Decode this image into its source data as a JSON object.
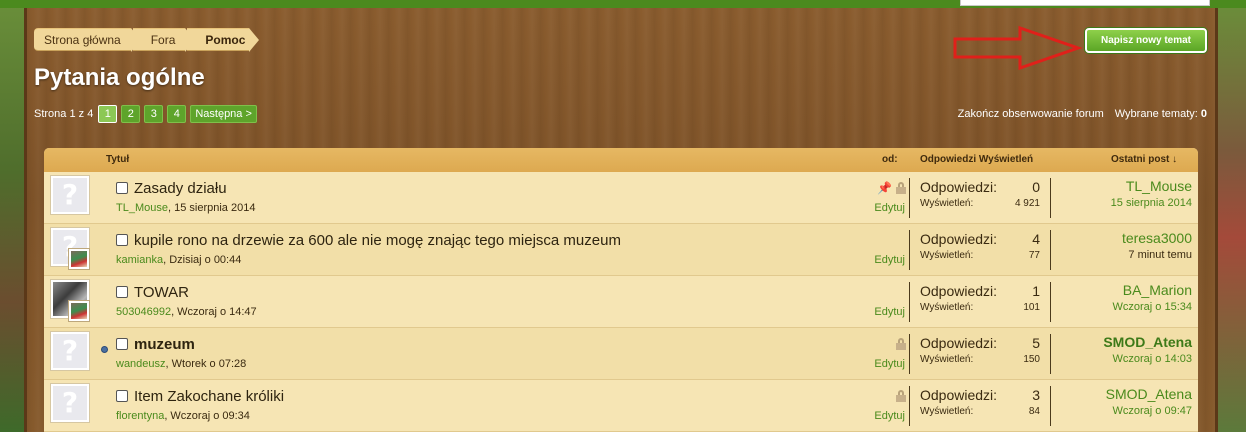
{
  "breadcrumb": [
    "Strona główna",
    "Fora",
    "Pomoc"
  ],
  "page_title": "Pytania ogólne",
  "new_topic_label": "Napisz nowy temat",
  "pagination": {
    "label": "Strona 1 z 4",
    "pages": [
      "1",
      "2",
      "3",
      "4"
    ],
    "current": "1",
    "next_label": "Następna >"
  },
  "forum_tools": {
    "unwatch": "Zakończ obserwowanie forum",
    "selected_label": "Wybrane tematy:",
    "selected_count": "0"
  },
  "columns": {
    "title": "Tytuł",
    "from": "od:",
    "replies_views": "Odpowiedzi Wyświetleń",
    "last_post": "Ostatni post ↓"
  },
  "threads": [
    {
      "title": "Zasady działu",
      "author": "TL_Mouse",
      "date": ", 15 sierpnia 2014",
      "edit": "Edytuj",
      "replies_label": "Odpowiedzi:",
      "replies": "0",
      "views_label": "Wyświetleń:",
      "views": "4 921",
      "last_user": "TL_Mouse",
      "last_date": "15 sierpnia 2014"
    },
    {
      "title": "kupile rono na drzewie za 600 ale nie mogę znając tego miejsca muzeum",
      "author": "kamianka",
      "date": ", Dzisiaj o 00:44",
      "edit": "Edytuj",
      "replies_label": "Odpowiedzi:",
      "replies": "4",
      "views_label": "Wyświetleń:",
      "views": "77",
      "last_user": "teresa3000",
      "last_date": "7 minut temu"
    },
    {
      "title": "TOWAR",
      "author": "503046992",
      "date": ", Wczoraj o 14:47",
      "edit": "Edytuj",
      "replies_label": "Odpowiedzi:",
      "replies": "1",
      "views_label": "Wyświetleń:",
      "views": "101",
      "last_user": "BA_Marion",
      "last_date": "Wczoraj o 15:34"
    },
    {
      "title": "muzeum",
      "author": "wandeusz",
      "date": ", Wtorek o 07:28",
      "edit": "Edytuj",
      "replies_label": "Odpowiedzi:",
      "replies": "5",
      "views_label": "Wyświetleń:",
      "views": "150",
      "last_user": "SMOD_Atena",
      "last_date": "Wczoraj o 14:03"
    },
    {
      "title": "Item Zakochane króliki",
      "author": "florentyna",
      "date": ", Wczoraj o 09:34",
      "edit": "Edytuj",
      "replies_label": "Odpowiedzi:",
      "replies": "3",
      "views_label": "Wyświetleń:",
      "views": "84",
      "last_user": "SMOD_Atena",
      "last_date": "Wczoraj o 09:47"
    }
  ]
}
